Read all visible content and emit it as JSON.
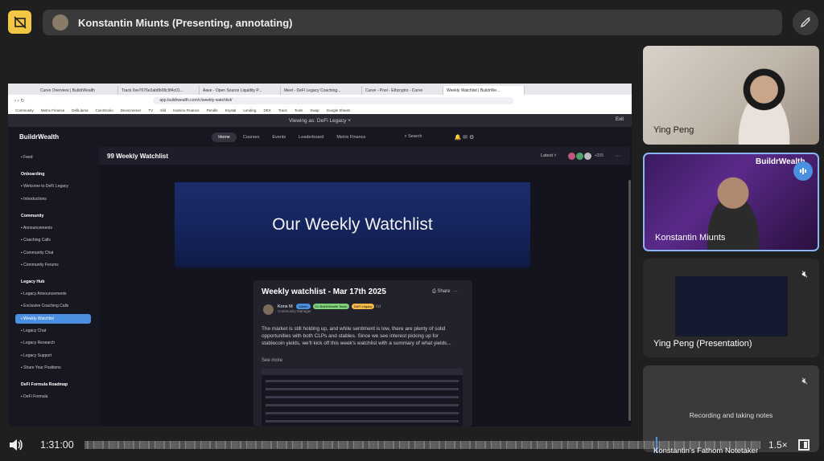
{
  "header": {
    "title": "Konstantin Miunts (Presenting, annotating)"
  },
  "browser": {
    "tabs": [
      "Curve Overview | BuildrWealth",
      "Track 0xe7076e3ab8b08c9f4c01...",
      "Aave - Open Source Liquidity P...",
      "Meet - DeFi Legacy Coaching...",
      "Curve - Pool - Ethcrypto - Curve",
      "Weekly Watchlist | BuildrWe..."
    ],
    "url": "app.buildrwealth.com/c/weekly-watchlist/",
    "bookmarks": [
      "Community",
      "Metrix Finance",
      "DefiLlama",
      "CoinGecko",
      "Dexscreener",
      "TV",
      "sfid",
      "Kamino Finance",
      "Pendle",
      "Krystal",
      "Lending",
      "DEX",
      "Track",
      "Tools",
      "Swap",
      "Google Sheets"
    ]
  },
  "app": {
    "viewing_as": "Viewing as: DeFi Legacy ˅",
    "exit": "Exit",
    "logo": "BuildrWealth",
    "nav": [
      "Home",
      "Courses",
      "Events",
      "Leaderboard",
      "Metrix Finance"
    ],
    "search": "Search",
    "feed_title": "99 Weekly Watchlist",
    "sort": "Latest",
    "member_count": "+205",
    "banner": "Our Weekly Watchlist",
    "post": {
      "title": "Weekly watchlist - Mar 17th 2025",
      "share": "Share",
      "author": "Kons M",
      "role": "Community Manager",
      "tags": [
        "Admin",
        "DJ BuildrWealth Team",
        "DeFi Legacy"
      ],
      "time": "6d",
      "body": "The market is still holding up, and while sentiment is low, there are plenty of solid opportunities with both CLPs and stables. Since we see interest picking up for stablecoin yields, we'll kick off this week's watchlist with a summary of what yields...",
      "see_more": "See more"
    },
    "sidebar": [
      {
        "type": "item",
        "label": "Feed"
      },
      {
        "type": "heading",
        "label": "Onboarding"
      },
      {
        "type": "item",
        "label": "Welcome to DeFi Legacy"
      },
      {
        "type": "item",
        "label": "Introductions"
      },
      {
        "type": "heading",
        "label": "Community"
      },
      {
        "type": "item",
        "label": "Announcements"
      },
      {
        "type": "item",
        "label": "Coaching Calls"
      },
      {
        "type": "item",
        "label": "Community Chat"
      },
      {
        "type": "item",
        "label": "Community Forums"
      },
      {
        "type": "heading",
        "label": "Legacy Hub"
      },
      {
        "type": "item",
        "label": "Legacy Announcements"
      },
      {
        "type": "item",
        "label": "Exclusive Coaching Calls"
      },
      {
        "type": "item",
        "label": "Weekly Watchlist",
        "selected": true
      },
      {
        "type": "item",
        "label": "Legacy Chat"
      },
      {
        "type": "item",
        "label": "Legacy Research"
      },
      {
        "type": "item",
        "label": "Legacy Support"
      },
      {
        "type": "item",
        "label": "Share Your Positions"
      },
      {
        "type": "heading",
        "label": "DeFi Formula Roadmap"
      },
      {
        "type": "item",
        "label": "DeFi Formula"
      }
    ]
  },
  "participants": [
    {
      "name": "Ying Peng"
    },
    {
      "name": "Konstantin Miunts",
      "speaking": true,
      "brand": "BuildrWealth"
    },
    {
      "name": "Ying Peng (Presentation)",
      "muted": true
    },
    {
      "name": "",
      "status": "Recording and taking notes",
      "muted": true
    }
  ],
  "player": {
    "time": "1:31:00",
    "speed": "1.5×",
    "speaker_label": "Konstantin's Fathom Notetaker",
    "progress_fraction": 0.85
  }
}
